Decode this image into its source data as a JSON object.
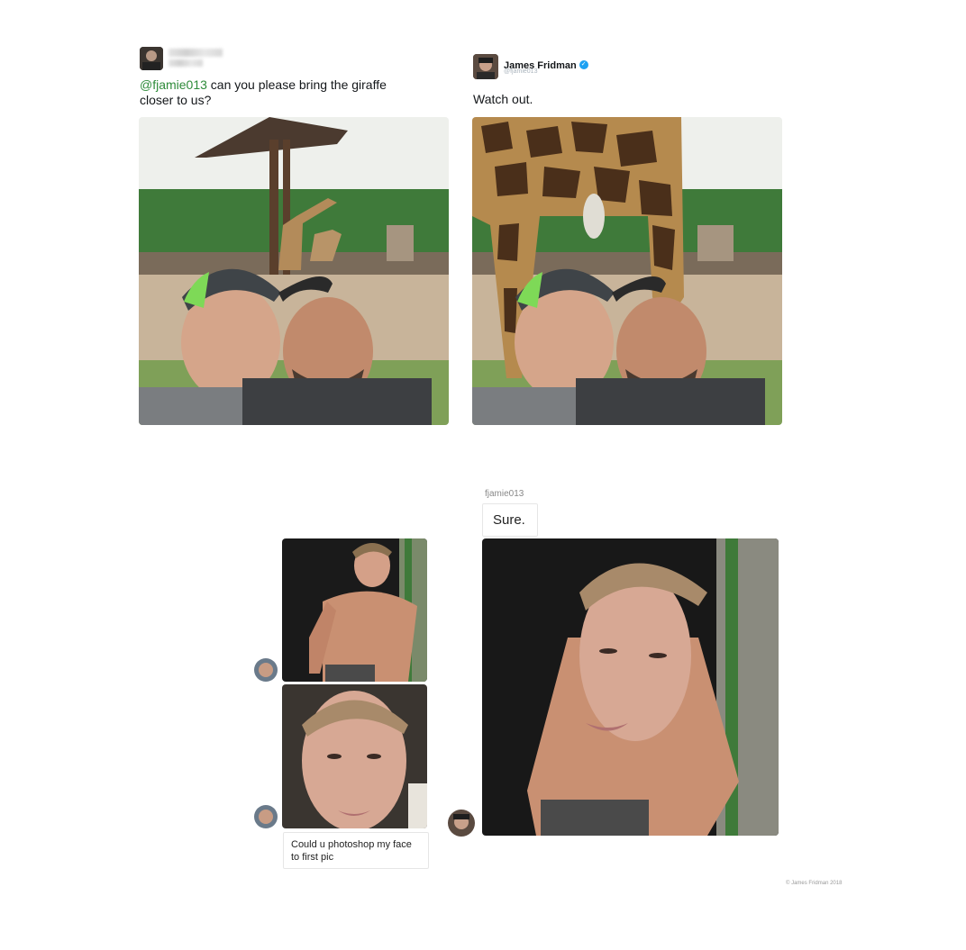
{
  "tweet_left": {
    "mention": "@fjamie013",
    "text": " can you please bring the giraffe closer to us?"
  },
  "tweet_right": {
    "name": "James Fridman",
    "handle": "@fjamie013",
    "text": "Watch out.",
    "verified_icon": "✓"
  },
  "dm": {
    "sender_label": "fjamie013",
    "reply": "Sure.",
    "request": "Could u photoshop my face to first pic"
  },
  "footer": {
    "copyright": "© James Fridman 2018"
  },
  "colors": {
    "mention": "#2e8b3a",
    "verified": "#1da1f2",
    "background": "#ffffff"
  }
}
